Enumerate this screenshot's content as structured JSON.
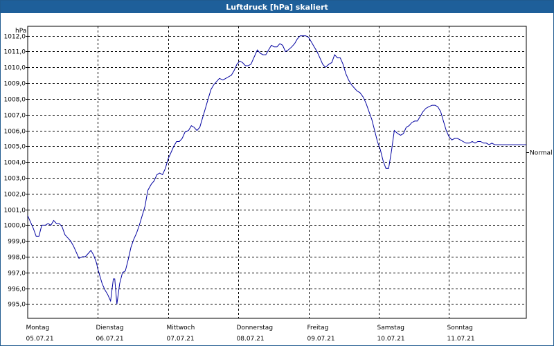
{
  "window": {
    "title": "Luftdruck [hPa] skaliert"
  },
  "chart_data": {
    "type": "line",
    "title": "Luftdruck [hPa] skaliert",
    "ylabel": "hPa",
    "ylim": [
      994.1,
      1012.6
    ],
    "yticks": [
      "995,0",
      "996,0",
      "997,0",
      "998,0",
      "999,0",
      "1000,0",
      "1001,0",
      "1002,0",
      "1003,0",
      "1004,0",
      "1005,0",
      "1006,0",
      "1007,0",
      "1008,0",
      "1009,0",
      "1010,0",
      "1011,0",
      "1012,0"
    ],
    "ytick_values": [
      995,
      996,
      997,
      998,
      999,
      1000,
      1001,
      1002,
      1003,
      1004,
      1005,
      1006,
      1007,
      1008,
      1009,
      1010,
      1011,
      1012
    ],
    "xlim": [
      0,
      7.1
    ],
    "xticks": [
      {
        "day": "Montag",
        "date": "05.07.21",
        "pos": 0
      },
      {
        "day": "Dienstag",
        "date": "06.07.21",
        "pos": 1
      },
      {
        "day": "Mittwoch",
        "date": "07.07.21",
        "pos": 2
      },
      {
        "day": "Donnerstag",
        "date": "08.07.21",
        "pos": 3
      },
      {
        "day": "Freitag",
        "date": "09.07.21",
        "pos": 4
      },
      {
        "day": "Samstag",
        "date": "10.07.21",
        "pos": 5
      },
      {
        "day": "Sonntag",
        "date": "11.07.21",
        "pos": 6
      }
    ],
    "reference": {
      "label": "Normal",
      "value": 1004.6
    },
    "grid": true,
    "series": [
      {
        "color": "#0000a0",
        "x": [
          0.0,
          0.04,
          0.08,
          0.12,
          0.16,
          0.2,
          0.25,
          0.29,
          0.33,
          0.37,
          0.41,
          0.45,
          0.49,
          0.53,
          0.57,
          0.61,
          0.65,
          0.69,
          0.73,
          0.78,
          0.82,
          0.86,
          0.9,
          0.94,
          0.98,
          1.0,
          1.02,
          1.06,
          1.1,
          1.14,
          1.18,
          1.22,
          1.24,
          1.27,
          1.31,
          1.35,
          1.39,
          1.43,
          1.47,
          1.51,
          1.55,
          1.59,
          1.63,
          1.67,
          1.71,
          1.76,
          1.8,
          1.84,
          1.88,
          1.92,
          1.96,
          2.0,
          2.04,
          2.08,
          2.12,
          2.16,
          2.2,
          2.24,
          2.29,
          2.33,
          2.37,
          2.41,
          2.45,
          2.49,
          2.53,
          2.57,
          2.61,
          2.65,
          2.69,
          2.73,
          2.78,
          2.82,
          2.86,
          2.9,
          2.94,
          2.98,
          3.02,
          3.06,
          3.1,
          3.14,
          3.18,
          3.22,
          3.27,
          3.31,
          3.35,
          3.39,
          3.43,
          3.47,
          3.51,
          3.55,
          3.59,
          3.63,
          3.67,
          3.71,
          3.76,
          3.8,
          3.84,
          3.88,
          3.92,
          3.96,
          4.0,
          4.04,
          4.08,
          4.12,
          4.16,
          4.2,
          4.24,
          4.29,
          4.33,
          4.37,
          4.41,
          4.45,
          4.49,
          4.53,
          4.57,
          4.61,
          4.65,
          4.69,
          4.73,
          4.78,
          4.82,
          4.86,
          4.9,
          4.94,
          4.98,
          5.02,
          5.06,
          5.1,
          5.14,
          5.18,
          5.22,
          5.27,
          5.31,
          5.35,
          5.39,
          5.43,
          5.47,
          5.51,
          5.55,
          5.59,
          5.63,
          5.67,
          5.71,
          5.76,
          5.8,
          5.84,
          5.88,
          5.92,
          5.96,
          6.0,
          6.04,
          6.08,
          6.12,
          6.16,
          6.2,
          6.24,
          6.29,
          6.33,
          6.37,
          6.41,
          6.45,
          6.49,
          6.53,
          6.57,
          6.61,
          6.65,
          6.69,
          6.73,
          6.78,
          6.82,
          6.86,
          6.9,
          6.94,
          6.98,
          7.02,
          7.06,
          7.1
        ],
        "y": [
          1000.6,
          1000.2,
          999.8,
          999.3,
          999.3,
          1000.0,
          1000.0,
          1000.1,
          1000.0,
          1000.3,
          1000.1,
          1000.1,
          999.9,
          999.4,
          999.2,
          999.0,
          998.7,
          998.3,
          997.9,
          998.0,
          998.0,
          998.2,
          998.4,
          998.1,
          997.6,
          997.2,
          996.9,
          996.3,
          995.9,
          995.6,
          995.2,
          996.6,
          996.6,
          995.0,
          996.3,
          997.0,
          997.1,
          997.8,
          998.6,
          999.1,
          999.5,
          1000.0,
          1000.6,
          1001.2,
          1002.2,
          1002.6,
          1002.8,
          1003.2,
          1003.3,
          1003.2,
          1003.6,
          1004.2,
          1004.6,
          1005.0,
          1005.3,
          1005.3,
          1005.5,
          1005.9,
          1006.0,
          1006.3,
          1006.2,
          1006.0,
          1006.2,
          1006.8,
          1007.4,
          1008.0,
          1008.6,
          1008.9,
          1009.1,
          1009.3,
          1009.2,
          1009.3,
          1009.4,
          1009.5,
          1009.8,
          1010.2,
          1010.4,
          1010.3,
          1010.1,
          1010.1,
          1010.2,
          1010.6,
          1011.1,
          1010.9,
          1010.8,
          1010.8,
          1011.1,
          1011.4,
          1011.3,
          1011.3,
          1011.5,
          1011.4,
          1011.0,
          1011.1,
          1011.3,
          1011.5,
          1011.8,
          1012.0,
          1012.0,
          1012.0,
          1011.9,
          1011.6,
          1011.3,
          1011.0,
          1010.6,
          1010.2,
          1010.0,
          1010.2,
          1010.3,
          1010.8,
          1010.6,
          1010.6,
          1010.2,
          1009.6,
          1009.2,
          1008.9,
          1008.7,
          1008.5,
          1008.4,
          1008.1,
          1007.7,
          1007.2,
          1006.7,
          1006.0,
          1005.3,
          1004.8,
          1004.1,
          1003.6,
          1003.6,
          1004.7,
          1006.0,
          1005.8,
          1005.7,
          1005.8,
          1006.2,
          1006.3,
          1006.5,
          1006.6,
          1006.6,
          1006.9,
          1007.2,
          1007.4,
          1007.5,
          1007.6,
          1007.6,
          1007.5,
          1007.2,
          1006.6,
          1006.0,
          1005.6,
          1005.4,
          1005.5,
          1005.5,
          1005.4,
          1005.3,
          1005.2,
          1005.2,
          1005.3,
          1005.2,
          1005.3,
          1005.3,
          1005.2,
          1005.2,
          1005.1,
          1005.2,
          1005.1,
          1005.1,
          1005.1,
          1005.1,
          1005.1,
          1005.1,
          1005.1,
          1005.1,
          1005.1,
          1005.1,
          1005.1,
          1005.1
        ]
      }
    ]
  }
}
